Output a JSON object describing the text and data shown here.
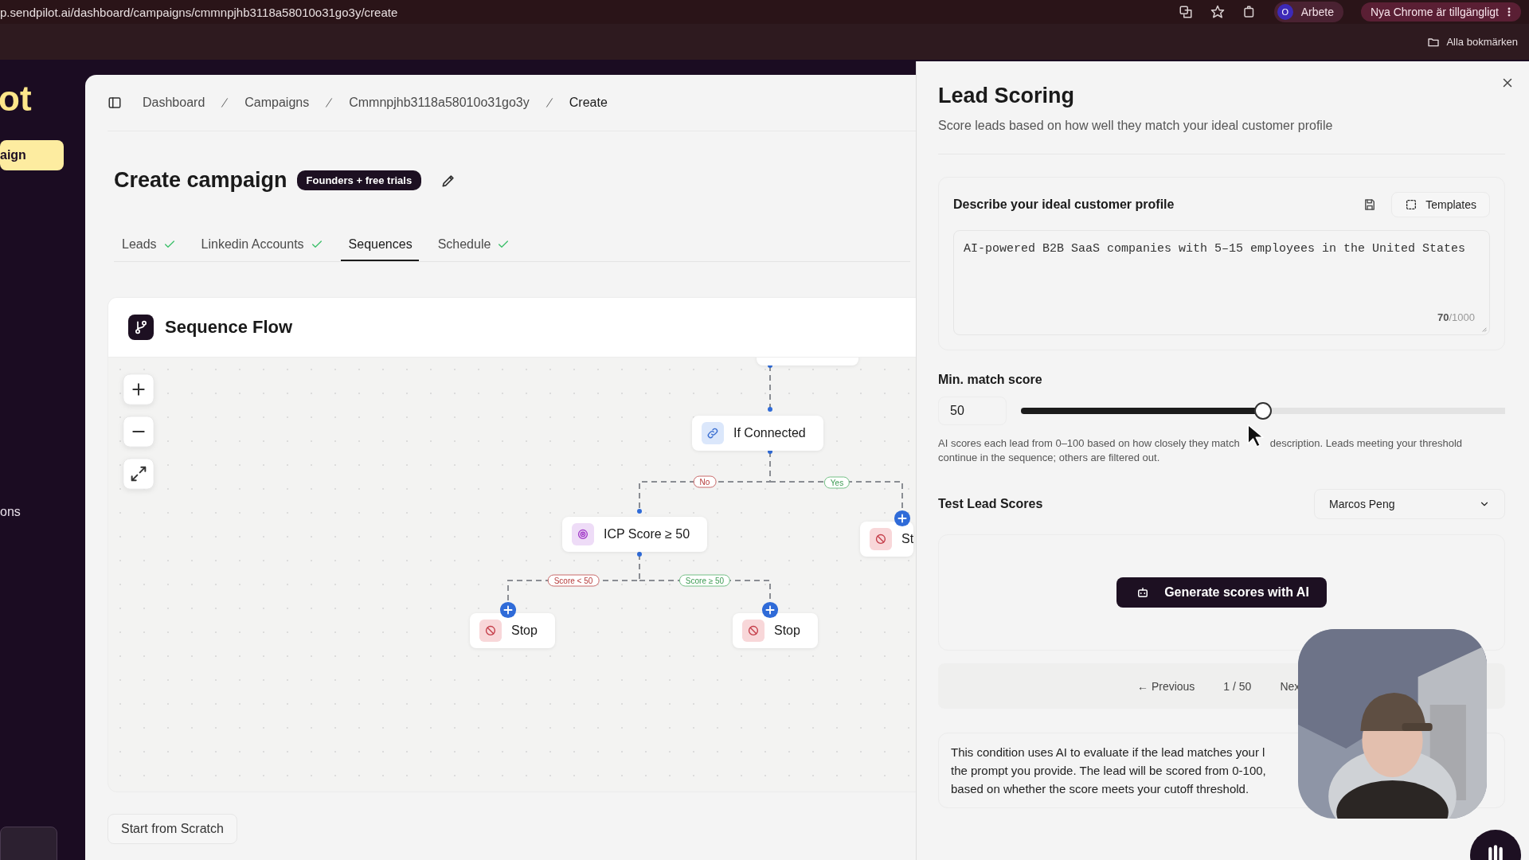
{
  "browser": {
    "url": "p.sendpilot.ai/dashboard/campaigns/cmmnpjhb3118a58010o31go3y/create",
    "profile": {
      "initial": "O",
      "name": "Arbete"
    },
    "update_notice": "Nya Chrome är tillgängligt",
    "bookmarks_label": "Alla bokmärken"
  },
  "sidebar": {
    "logo_text": "ot",
    "items": [
      {
        "label": "aign",
        "selected": true
      },
      {
        "label": "ons",
        "selected": false
      }
    ]
  },
  "breadcrumb": [
    "Dashboard",
    "Campaigns",
    "Cmmnpjhb3118a58010o31go3y",
    "Create"
  ],
  "page": {
    "title": "Create campaign",
    "badge": "Founders + free trials"
  },
  "tabs": [
    {
      "label": "Leads",
      "complete": true,
      "selected": false
    },
    {
      "label": "Linkedin Accounts",
      "complete": true,
      "selected": false
    },
    {
      "label": "Sequences",
      "complete": false,
      "selected": true
    },
    {
      "label": "Schedule",
      "complete": true,
      "selected": false
    }
  ],
  "flow": {
    "title": "Sequence Flow",
    "nodes": [
      {
        "label": "If Connected",
        "kind": "condition"
      },
      {
        "label": "ICP Score ≥ 50",
        "kind": "score"
      },
      {
        "label": "Stop",
        "kind": "stop"
      },
      {
        "label": "Stop",
        "kind": "stop"
      },
      {
        "label": "St",
        "kind": "stop"
      }
    ],
    "edge_labels": [
      {
        "label": "No",
        "kind": "negative"
      },
      {
        "label": "Yes",
        "kind": "positive"
      },
      {
        "label": "Score < 50",
        "kind": "negative"
      },
      {
        "label": "Score ≥ 50",
        "kind": "positive"
      }
    ]
  },
  "start_button": "Start from Scratch",
  "panel": {
    "title": "Lead Scoring",
    "subtitle": "Score leads based on how well they match your ideal customer profile",
    "profile_card": {
      "heading": "Describe your ideal customer profile",
      "templates_button": "Templates",
      "value": "AI-powered B2B SaaS companies with 5–15 employees in the United States",
      "count": "70",
      "limit": "/1000"
    },
    "min_score": {
      "label": "Min. match score",
      "value": "50",
      "level": 0.5,
      "hint_parts": [
        "AI scores each lead from 0–100 based on how closely they match",
        "description. Leads meeting your threshold",
        "continue in the sequence; others are filtered out."
      ]
    },
    "test": {
      "label": "Test Lead Scores",
      "lead": "Marcos Peng",
      "generate_button": "Generate scores with AI",
      "previous": "← Previous",
      "page": "1 / 50",
      "next": "Nex"
    },
    "info": "This condition uses AI to evaluate if the lead matches your l\nthe prompt you provide. The lead will be scored from 0-100,\nbased on whether the score meets your cutoff threshold."
  }
}
